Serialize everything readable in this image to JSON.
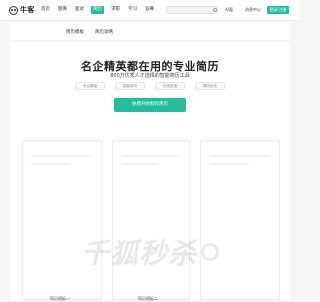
{
  "header": {
    "logo_text": "牛客",
    "nav": [
      "首页",
      "题库",
      "面试",
      "简历",
      "求职",
      "学习",
      "竞赛"
    ],
    "active_index": 3,
    "lang_label": "AI面",
    "login_label": "消息中心",
    "register_label": "登录/注册"
  },
  "subnav": {
    "tabs": [
      "简历模板",
      "简历攻略"
    ]
  },
  "hero": {
    "title": "名企精英都在用的专业简历",
    "subtitle": "800万优秀人才选择的智能简历工具",
    "tags": [
      "专业模板",
      "智能填写",
      "在线投递",
      "简历优化"
    ],
    "cta_label": "免费开始制作简历"
  },
  "previews": {
    "footer_labels": [
      "简历模板一",
      "简历模板二"
    ]
  },
  "watermark": {
    "text": "千狐秒杀"
  },
  "colors": {
    "accent": "#25bb9b",
    "background": "#f4f6f8"
  }
}
